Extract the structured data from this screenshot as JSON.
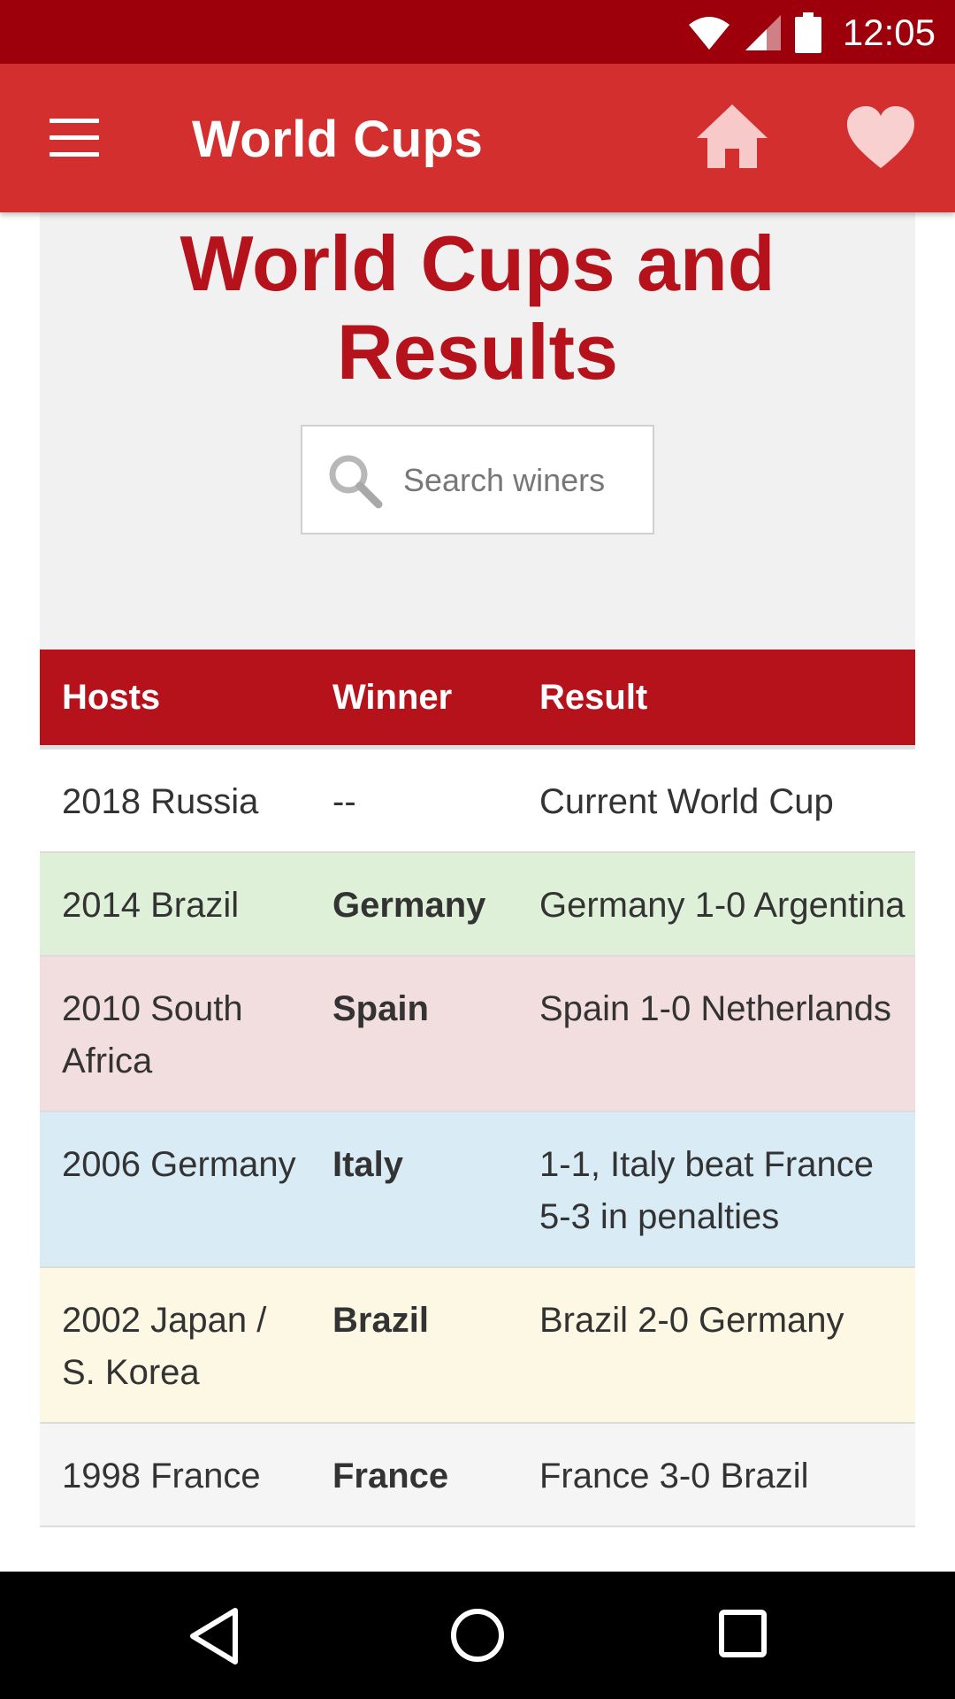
{
  "status_bar": {
    "time": "12:05",
    "icons": [
      "wifi-icon",
      "cell-signal-icon",
      "battery-icon"
    ]
  },
  "app_bar": {
    "title": "World Cups",
    "icons": [
      "menu-icon",
      "home-icon",
      "heart-icon"
    ],
    "background_color": "#d32f2f"
  },
  "hero": {
    "title_line1": "World Cups and",
    "title_line2": "Results",
    "title_color": "#b5121b",
    "search": {
      "placeholder": "Search winers",
      "value": ""
    }
  },
  "table": {
    "headers": [
      "Hosts",
      "Winner",
      "Result"
    ],
    "header_color": "#b5121b",
    "rows": [
      {
        "host": "2018 Russia",
        "winner": "--",
        "result": "Current World Cup",
        "color": "#ffffff"
      },
      {
        "host": "2014 Brazil",
        "winner": "Germany",
        "result": "Germany 1-0 Argentina",
        "color": "#dff0d8"
      },
      {
        "host": "2010 South Africa",
        "winner": "Spain",
        "result": "Spain 1-0 Netherlands",
        "color": "#f2dede"
      },
      {
        "host": "2006 Germany",
        "winner": "Italy",
        "result": "1-1, Italy beat France 5-3 in penalties",
        "color": "#d9ecf6"
      },
      {
        "host": "2002 Japan / S. Korea",
        "winner": "Brazil",
        "result": "Brazil 2-0 Germany",
        "color": "#fcf8e3"
      },
      {
        "host": "1998 France",
        "winner": "France",
        "result": "France 3-0 Brazil",
        "color": "#f5f5f5"
      }
    ]
  },
  "nav_bar": {
    "icons": [
      "back-icon",
      "home-circle-icon",
      "recent-apps-icon"
    ]
  }
}
